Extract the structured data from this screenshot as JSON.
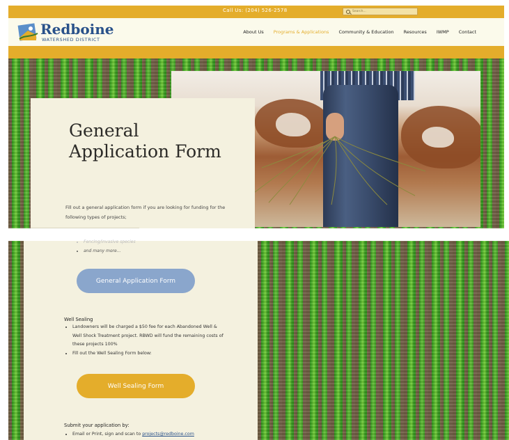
{
  "topbar": {
    "call_text": "Call Us: (204) 526-2578",
    "search_placeholder": "Search..."
  },
  "header": {
    "logo_name": "Redboine",
    "logo_sub": "WATERSHED DISTRICT",
    "nav": [
      "About Us",
      "Programs & Applications",
      "Community & Education",
      "Resources",
      "IWMP",
      "Contact"
    ],
    "active_nav": "Programs & Applications"
  },
  "hero": {
    "title": "General Application Form",
    "intro": "Fill out a general application form if you are looking for funding for the following types of projects;"
  },
  "content": {
    "project_items": [
      "Fencing/invasive species",
      "and many more..."
    ],
    "general_button": "General Application Form",
    "well_heading": "Well Sealing",
    "well_items": [
      "Landowners will be charged a $50 fee for each Abandoned Well & Well Shock Treatment project.  RBWD will fund the remaining costs of these projects 100%",
      "Fill out the Well Sealing Form below:"
    ],
    "well_button": "Well Sealing Form",
    "submit_heading": "Submit your application by:",
    "submit_text": "Email or Print, sign and scan to ",
    "submit_email": "projects@redboine.com"
  },
  "colors": {
    "gold": "#e4ad2b",
    "blue_button": "#8aa6cc",
    "card_bg": "#f4f1df",
    "brand_blue": "#29518a"
  }
}
